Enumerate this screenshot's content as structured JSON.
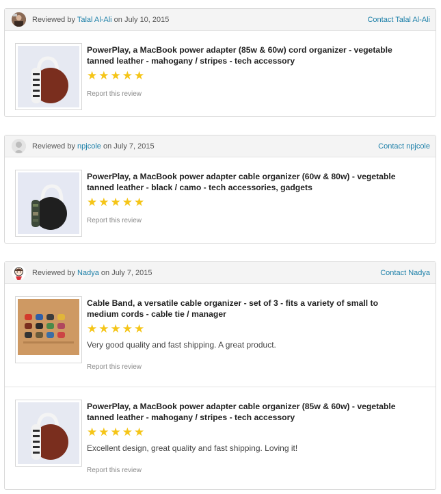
{
  "colors": {
    "link": "#1b7fa8",
    "star": "#f5c518",
    "header_bg": "#f4f4f4"
  },
  "reviews": [
    {
      "reviewed_by_prefix": "Reviewed by",
      "reviewer": "Talal Al-Ali",
      "date_text": "on July 10, 2015",
      "contact": "Contact Talal Al-Ali",
      "avatar_icon": "user-photo-icon",
      "items": [
        {
          "title": "PowerPlay, a MacBook power adapter (85w & 60w) cord organizer - vegetable tanned leather - mahogany / stripes - tech accessory",
          "rating": 5,
          "text": "",
          "report": "Report this review",
          "image": "mahogany-cord-organizer-image"
        }
      ]
    },
    {
      "reviewed_by_prefix": "Reviewed by",
      "reviewer": "npjcole",
      "date_text": "on July 7, 2015",
      "contact": "Contact npjcole",
      "avatar_icon": "default-avatar-icon",
      "items": [
        {
          "title": "PowerPlay, a MacBook power adapter cable organizer (60w & 80w) - vegetable tanned leather - black / camo - tech accessories, gadgets",
          "rating": 5,
          "text": "",
          "report": "Report this review",
          "image": "black-camo-cord-organizer-image"
        }
      ]
    },
    {
      "reviewed_by_prefix": "Reviewed by",
      "reviewer": "Nadya",
      "date_text": "on July 7, 2015",
      "contact": "Contact Nadya",
      "avatar_icon": "cartoon-avatar-icon",
      "items": [
        {
          "title": "Cable Band, a versatile cable organizer - set of 3 - fits a variety of small to medium cords - cable tie / manager",
          "rating": 5,
          "text": "Very good quality and fast shipping. A great product.",
          "report": "Report this review",
          "image": "cable-band-set-image"
        },
        {
          "title": "PowerPlay, a MacBook power adapter cable organizer (85w & 60w) - vegetable tanned leather - mahogany / stripes - tech accessory",
          "rating": 5,
          "text": "Excellent design, great quality and fast shipping. Loving it!",
          "report": "Report this review",
          "image": "mahogany-cord-organizer-image"
        }
      ]
    }
  ]
}
